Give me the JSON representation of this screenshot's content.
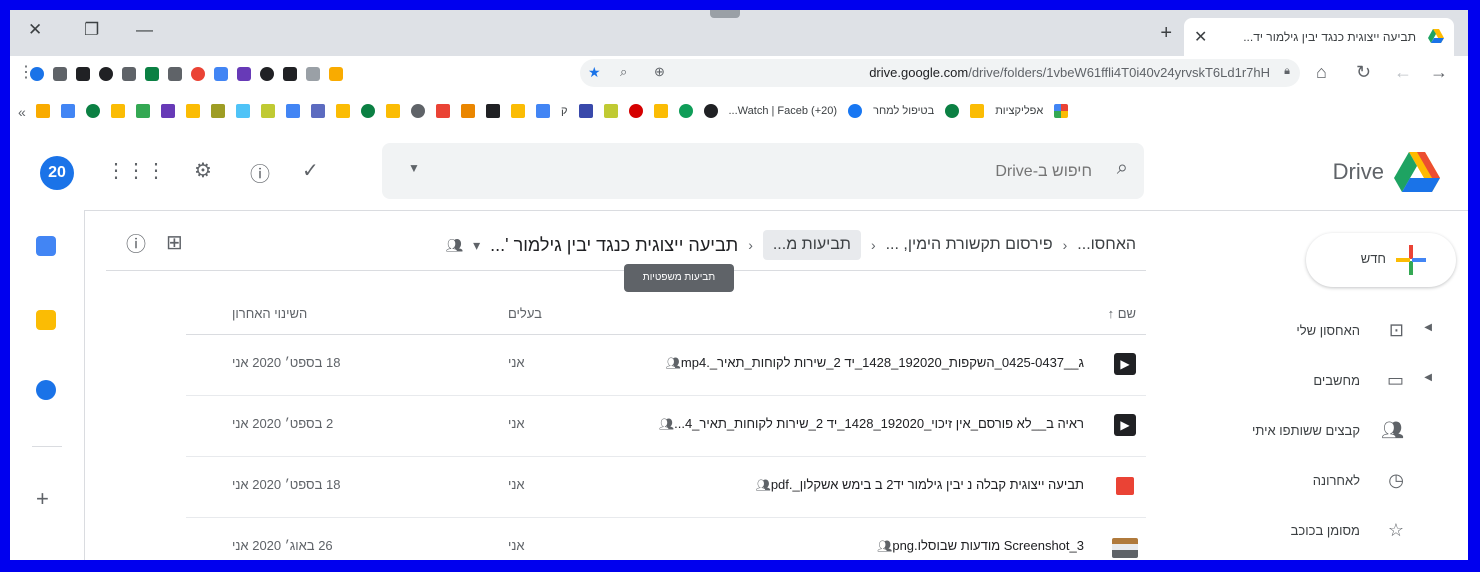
{
  "browser": {
    "tab_title": "תביעה ייצוגית כנגד יבין גילמור יד...",
    "url_host": "drive.google.com",
    "url_path": "/drive/folders/1vbeW61ffli4T0i40v24yrvskT6Ld1r7hH",
    "bookmarks": [
      {
        "label": "(20+) Watch | Faceb..."
      },
      {
        "label": "בטיפול למחר"
      },
      {
        "label": "אפליקציות"
      }
    ],
    "bm_q": "ק"
  },
  "drive": {
    "app_name": "Drive",
    "search_placeholder": "חיפוש ב-Drive",
    "account_badge": "20",
    "new_label": "חדש",
    "sidebar": [
      {
        "label": "האחסון שלי",
        "icon": "drive-folder-icon"
      },
      {
        "label": "מחשבים",
        "icon": "computer-icon"
      },
      {
        "label": "קבצים ששותפו איתי",
        "icon": "people-icon"
      },
      {
        "label": "לאחרונה",
        "icon": "clock-icon"
      },
      {
        "label": "מסומן בכוכב",
        "icon": "star-icon"
      }
    ],
    "breadcrumbs": [
      {
        "label": "האחסו..."
      },
      {
        "label": "פירסום תקשורת הימין, ..."
      },
      {
        "label": "תביעות מ..."
      },
      {
        "label": "תביעה ייצוגית כנגד יבין גילמור '..."
      }
    ],
    "tooltip": "תביעות משפטיות",
    "columns": {
      "name": "שם",
      "owner": "בעלים",
      "modified": "השינוי האחרון"
    },
    "files": [
      {
        "name": "ג__0425-0437_השקפות_192020_1428_יד 2_שירות לקוחות_תאיר_.mp4",
        "type": "video",
        "owner": "אני",
        "modified": "18 בספט׳ 2020 אני"
      },
      {
        "name": "ראיה ב__לא פורסם_אין זיכוי_192020_1428_יד 2_שירות לקוחות_תאיר_4...",
        "type": "video",
        "owner": "אני",
        "modified": "2 בספט׳ 2020 אני"
      },
      {
        "name": "תביעה ייצוגית קבלה נ יבין גילמור יד2 ב בימש אשקלון_.pdf",
        "type": "pdf",
        "owner": "אני",
        "modified": "18 בספט׳ 2020 אני"
      },
      {
        "name": "Screenshot_3 מודעות שבוסלו.png",
        "type": "image",
        "owner": "אני",
        "modified": "26 באוג׳ 2020 אני"
      }
    ]
  },
  "colors": {
    "frame_border": "#0000ee",
    "drive_blue": "#1a73e8",
    "drive_green": "#1ea362",
    "drive_yellow": "#ffba00",
    "drive_red": "#ea4335"
  }
}
